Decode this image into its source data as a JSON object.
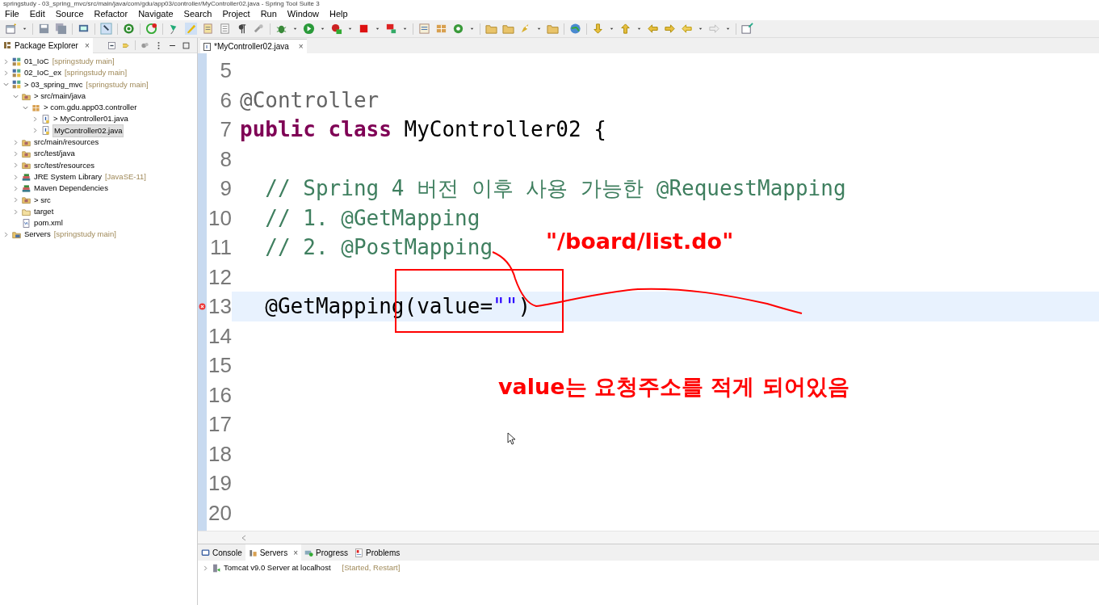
{
  "window": {
    "title": "springstudy - 03_spring_mvc/src/main/java/com/gdu/app03/controller/MyController02.java - Spring Tool Suite 3"
  },
  "menu": [
    "File",
    "Edit",
    "Source",
    "Refactor",
    "Navigate",
    "Search",
    "Project",
    "Run",
    "Window",
    "Help"
  ],
  "package_explorer": {
    "title": "Package Explorer",
    "close": "×",
    "tree": [
      {
        "kind": "project",
        "label": "01_IoC",
        "decoration": "[springstudy main]",
        "expanded": false,
        "selected": false
      },
      {
        "kind": "project",
        "label": "02_IoC_ex",
        "decoration": "[springstudy main]",
        "expanded": false,
        "selected": false
      },
      {
        "kind": "project",
        "prefix": ">",
        "label": "03_spring_mvc",
        "decoration": "[springstudy main]",
        "expanded": true,
        "selected": false,
        "children": [
          {
            "kind": "source-folder",
            "prefix": ">",
            "label": "src/main/java",
            "expanded": true,
            "selected": false,
            "children": [
              {
                "kind": "package",
                "prefix": ">",
                "label": "com.gdu.app03.controller",
                "expanded": true,
                "selected": false,
                "children": [
                  {
                    "kind": "java-file",
                    "prefix": ">",
                    "label": "MyController01.java",
                    "expanded": false,
                    "selected": false
                  },
                  {
                    "kind": "java-file",
                    "label": "MyController02.java",
                    "expanded": false,
                    "selected": true
                  }
                ]
              }
            ]
          },
          {
            "kind": "source-folder",
            "label": "src/main/resources",
            "expanded": false,
            "selected": false
          },
          {
            "kind": "source-folder",
            "label": "src/test/java",
            "expanded": false,
            "selected": false
          },
          {
            "kind": "source-folder",
            "label": "src/test/resources",
            "expanded": false,
            "selected": false
          },
          {
            "kind": "library",
            "label": "JRE System Library",
            "decoration": "[JavaSE-11]",
            "expanded": false,
            "selected": false
          },
          {
            "kind": "library",
            "label": "Maven Dependencies",
            "expanded": false,
            "selected": false
          },
          {
            "kind": "source-folder",
            "prefix": ">",
            "label": "src",
            "expanded": false,
            "selected": false
          },
          {
            "kind": "folder",
            "label": "target",
            "expanded": false,
            "selected": false
          },
          {
            "kind": "file",
            "label": "pom.xml",
            "selected": false
          }
        ]
      },
      {
        "kind": "servers",
        "label": "Servers",
        "decoration": "[springstudy main]",
        "expanded": false,
        "selected": false
      }
    ]
  },
  "editor": {
    "tab": {
      "title": "*MyController02.java",
      "close": "×"
    },
    "lines": [
      {
        "number": "5"
      },
      {
        "number": "6",
        "segments": [
          {
            "kind": "annotation",
            "text": "@Controller"
          }
        ]
      },
      {
        "number": "7",
        "segments": [
          {
            "kind": "keyword",
            "text": "public class"
          },
          {
            "kind": "plain",
            "text": " MyController02 {"
          }
        ]
      },
      {
        "number": "8"
      },
      {
        "number": "9",
        "segments": [
          {
            "kind": "comment",
            "text": "  // Spring 4 버전 이후 사용 가능한 @RequestMapping"
          }
        ]
      },
      {
        "number": "10",
        "segments": [
          {
            "kind": "comment",
            "text": "  // 1. @GetMapping"
          }
        ]
      },
      {
        "number": "11",
        "segments": [
          {
            "kind": "comment",
            "text": "  // 2. @PostMapping"
          }
        ]
      },
      {
        "number": "12"
      },
      {
        "number": "13",
        "current": true,
        "error": true,
        "segments": [
          {
            "kind": "plain",
            "text": "  @GetMapping(value="
          },
          {
            "kind": "string",
            "text": "\"\""
          },
          {
            "kind": "plain",
            "text": ")"
          }
        ]
      },
      {
        "number": "14"
      },
      {
        "number": "15"
      },
      {
        "number": "16"
      },
      {
        "number": "17"
      },
      {
        "number": "18"
      },
      {
        "number": "19"
      },
      {
        "number": "20"
      }
    ]
  },
  "annotations": [
    {
      "kind": "text",
      "text": "\"/board/list.do\""
    },
    {
      "kind": "text",
      "text": "value는 요청주소를 적게 되어있음"
    },
    {
      "kind": "box"
    },
    {
      "kind": "stroke"
    }
  ],
  "bottom_panel": {
    "tabs": [
      {
        "label": "Console",
        "selected": false
      },
      {
        "label": "Servers",
        "selected": true,
        "close": "×"
      },
      {
        "label": "Progress",
        "selected": false
      },
      {
        "label": "Problems",
        "selected": false
      }
    ],
    "servers": [
      {
        "label": "Tomcat v9.0 Server at localhost",
        "state": "[Started, Restart]",
        "expanded": false
      }
    ]
  }
}
